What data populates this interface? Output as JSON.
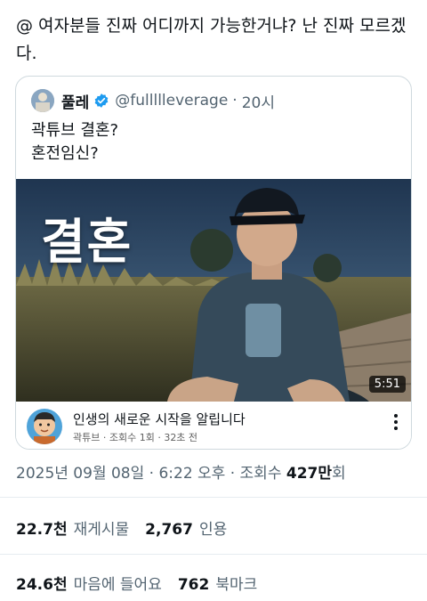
{
  "tweet": {
    "text": "@ 여자분들 진짜 어디까지 가능한거냐? 난 진짜 모르겠다."
  },
  "quote": {
    "name": "풀레",
    "handle": "@fullllleverage",
    "separator": "·",
    "time": "20시",
    "line1": "곽튜브 결혼?",
    "line2": "혼전임신?",
    "video": {
      "overlay_title": "결혼",
      "duration": "5:51",
      "title": "인생의 새로운 시작을 알립니다",
      "meta": "곽튜브 · 조회수 1회 · 32초 전"
    }
  },
  "timestamp": {
    "prefix": "2025년 09월 08일 · 6:22 오후 · 조회수 ",
    "views": "427만",
    "suffix": "회"
  },
  "stats": {
    "reposts_num": "22.7천",
    "reposts_label": "재게시물",
    "quotes_num": "2,767",
    "quotes_label": "인용",
    "likes_num": "24.6천",
    "likes_label": "마음에 들어요",
    "bookmarks_num": "762",
    "bookmarks_label": "북마크"
  },
  "colors": {
    "verified": "#1d9bf0",
    "secondary_text": "#536471",
    "primary_text": "#0f1419"
  }
}
